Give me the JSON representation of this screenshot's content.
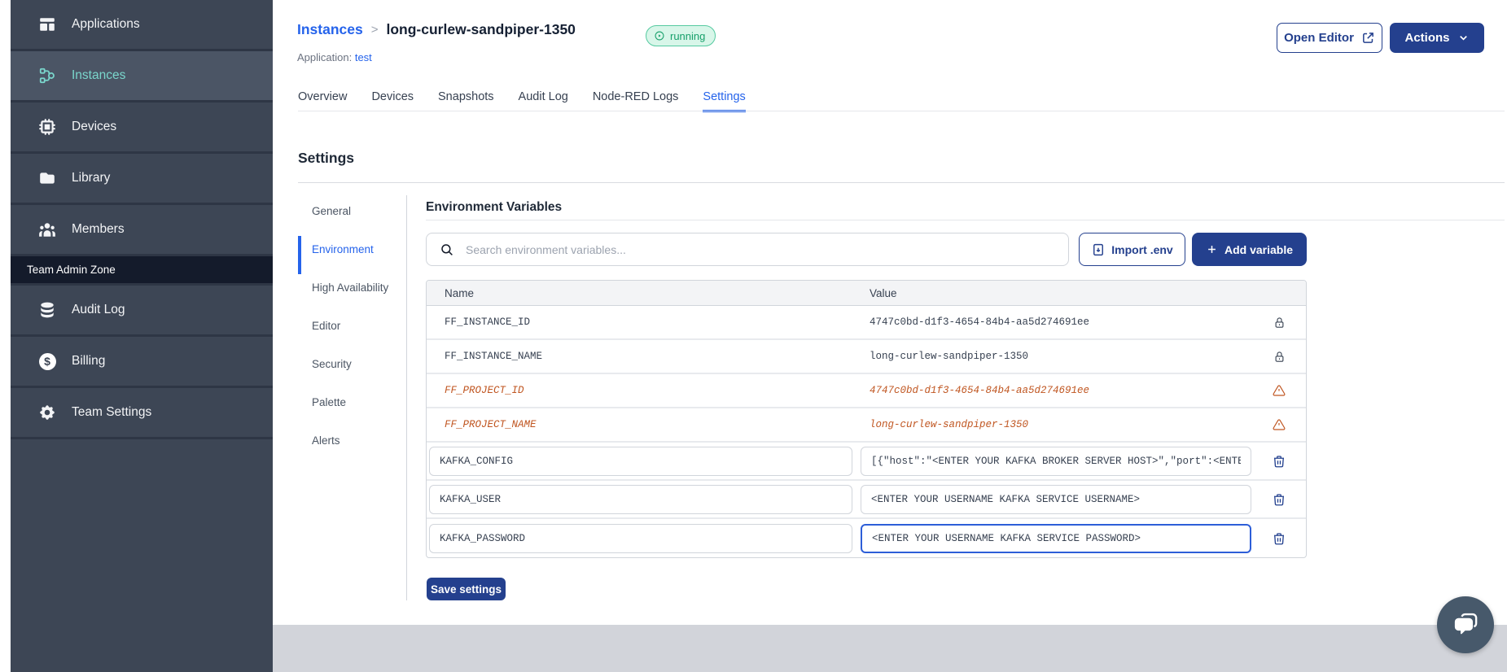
{
  "sidebar": {
    "items": [
      {
        "label": "Applications",
        "icon": "applications-icon"
      },
      {
        "label": "Instances",
        "icon": "instances-icon"
      },
      {
        "label": "Devices",
        "icon": "chip-icon"
      },
      {
        "label": "Library",
        "icon": "folder-icon"
      },
      {
        "label": "Members",
        "icon": "users-icon"
      }
    ],
    "section_label": "Team Admin Zone",
    "admin_items": [
      {
        "label": "Audit Log",
        "icon": "database-icon"
      },
      {
        "label": "Billing",
        "icon": "dollar-icon"
      },
      {
        "label": "Team Settings",
        "icon": "gear-icon"
      }
    ]
  },
  "header": {
    "breadcrumb_root": "Instances",
    "breadcrumb_separator": ">",
    "instance_name": "long-curlew-sandpiper-1350",
    "status": "running",
    "application_label": "Application:",
    "application_name": "test",
    "open_editor_label": "Open Editor",
    "actions_label": "Actions"
  },
  "tabs": [
    "Overview",
    "Devices",
    "Snapshots",
    "Audit Log",
    "Node-RED Logs",
    "Settings"
  ],
  "settings": {
    "title": "Settings",
    "nav": [
      "General",
      "Environment",
      "High Availability",
      "Editor",
      "Security",
      "Palette",
      "Alerts"
    ]
  },
  "env": {
    "title": "Environment Variables",
    "search_placeholder": "Search environment variables...",
    "import_label": "Import .env",
    "add_label": "Add variable",
    "save_label": "Save settings",
    "columns": {
      "name": "Name",
      "value": "Value"
    },
    "rows": [
      {
        "name": "FF_INSTANCE_ID",
        "value": "4747c0bd-d1f3-4654-84b4-aa5d274691ee",
        "type": "locked"
      },
      {
        "name": "FF_INSTANCE_NAME",
        "value": "long-curlew-sandpiper-1350",
        "type": "locked"
      },
      {
        "name": "FF_PROJECT_ID",
        "value": "4747c0bd-d1f3-4654-84b4-aa5d274691ee",
        "type": "deprecated"
      },
      {
        "name": "FF_PROJECT_NAME",
        "value": "long-curlew-sandpiper-1350",
        "type": "deprecated"
      },
      {
        "name": "KAFKA_CONFIG",
        "value": "[{\"host\":\"<ENTER YOUR KAFKA BROKER SERVER HOST>\",\"port\":<ENTER PORT>}]",
        "type": "editable"
      },
      {
        "name": "KAFKA_USER",
        "value": "<ENTER YOUR USERNAME KAFKA SERVICE USERNAME>",
        "type": "editable"
      },
      {
        "name": "KAFKA_PASSWORD",
        "value": "<ENTER YOUR USERNAME KAFKA SERVICE PASSWORD>",
        "type": "editable",
        "focused": true
      }
    ]
  },
  "colors": {
    "accent_blue": "#2563eb",
    "navy": "#24408e",
    "sidebar_teal": "#7ad6cc",
    "status_green": "#18a06b",
    "warning_orange": "#c05621"
  }
}
